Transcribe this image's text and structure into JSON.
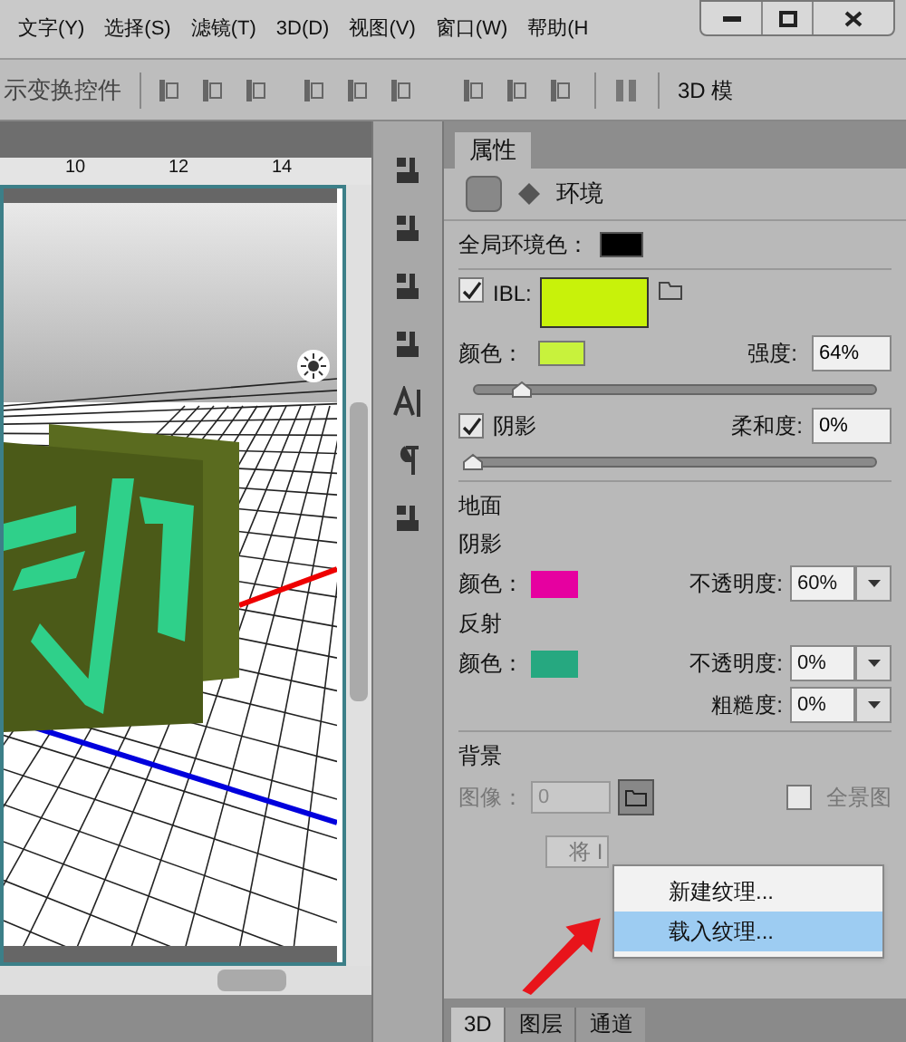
{
  "menu": [
    {
      "label": "文字(Y)"
    },
    {
      "label": "选择(S)"
    },
    {
      "label": "滤镜(T)"
    },
    {
      "label": "3D(D)"
    },
    {
      "label": "视图(V)"
    },
    {
      "label": "窗口(W)"
    },
    {
      "label": "帮助(H"
    }
  ],
  "options_bar": {
    "label": "示变换控件",
    "mode_label": "3D 模"
  },
  "ruler": [
    "10",
    "12",
    "14"
  ],
  "properties": {
    "tab": "属性",
    "header": "环境",
    "global_ambient": {
      "label": "全局环境色：",
      "color": "#000000"
    },
    "ibl": {
      "checked": true,
      "label": "IBL:",
      "color": "#c8f20a"
    },
    "ibl_color": {
      "label": "颜色：",
      "color": "#c8f23c",
      "intensity_label": "强度:",
      "intensity": "64%",
      "level": 0.12
    },
    "shadow": {
      "checked": true,
      "label": "阴影",
      "softness_label": "柔和度:",
      "softness": "0%",
      "level": 0
    },
    "ground": {
      "title": "地面",
      "shadow_title": "阴影",
      "color_label": "颜色：",
      "color": "#e600a0",
      "opacity_label": "不透明度:",
      "opacity": "60%"
    },
    "reflection": {
      "title": "反射",
      "color_label": "颜色：",
      "color": "#26a880",
      "opacity_label": "不透明度:",
      "opacity": "0%",
      "roughness_label": "粗糙度:",
      "roughness": "0%"
    },
    "background": {
      "title": "背景",
      "image_label": "图像：",
      "image_value": "0",
      "panorama_label": "全景图",
      "panorama_checked": false,
      "button": "将 I"
    },
    "menu_items": [
      {
        "label": "新建纹理...",
        "selected": false
      },
      {
        "label": "载入纹理...",
        "selected": true
      }
    ]
  },
  "bottom_tabs": [
    {
      "label": "3D",
      "selected": true
    },
    {
      "label": "图层",
      "selected": false
    },
    {
      "label": "通道",
      "selected": false
    }
  ]
}
